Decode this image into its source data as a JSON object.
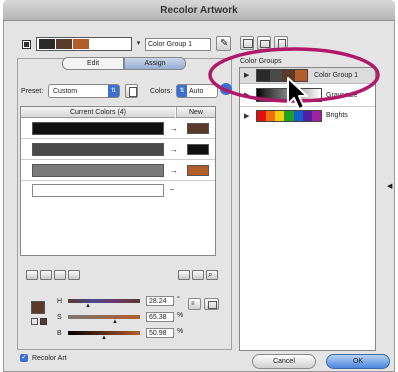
{
  "window": {
    "title": "Recolor Artwork"
  },
  "top": {
    "group_name_value": "Color Group 1",
    "active_swatches": [
      "#2a2a2a",
      "#5a3b2a",
      "#b35e2a"
    ]
  },
  "tabs": [
    {
      "label": "Edit"
    },
    {
      "label": "Assign"
    }
  ],
  "preset": {
    "label": "Preset:",
    "value": "Custom"
  },
  "colors": {
    "label": "Colors:",
    "value": "Auto"
  },
  "table": {
    "col_current": "Current Colors (4)",
    "col_new": "New",
    "rows": [
      {
        "current": "#111111",
        "new": "#5a3b2a",
        "arrow": "→"
      },
      {
        "current": "#4a4a4a",
        "new": "#111111",
        "arrow": "→"
      },
      {
        "current": "#7a7a7a",
        "new": "#b35e2a",
        "arrow": "→"
      },
      {
        "current": "#ffffff",
        "new": "",
        "arrow": "–"
      }
    ]
  },
  "hsb": {
    "h_label": "H",
    "s_label": "S",
    "b_label": "B",
    "h_value": "28.24",
    "s_value": "65.38",
    "b_value": "50.98",
    "h_unit": "°",
    "s_unit": "%",
    "b_unit": "%",
    "h_pos": 0.28,
    "s_pos": 0.65,
    "b_pos": 0.51,
    "swatch_color": "#5a3b2a"
  },
  "right": {
    "groups_label": "Color Groups",
    "groups": [
      {
        "name": "Color Group 1",
        "swatches": [
          "#2a2a2a",
          "#4a4a4a",
          "#5a3b2a",
          "#b35e2a"
        ]
      },
      {
        "name": "Grayscale",
        "swatches": [
          "#000",
          "#333",
          "#555",
          "#777",
          "#999",
          "#bbb",
          "#ddd",
          "#fff"
        ]
      },
      {
        "name": "Brights",
        "swatches": [
          "#e01010",
          "#f07010",
          "#f0d010",
          "#20a020",
          "#1060d0",
          "#5020a0",
          "#a020a0"
        ]
      }
    ]
  },
  "footer": {
    "recolor_art_label": "Recolor Art",
    "cancel_label": "Cancel",
    "ok_label": "OK"
  },
  "highlight_color": "#b0186a"
}
